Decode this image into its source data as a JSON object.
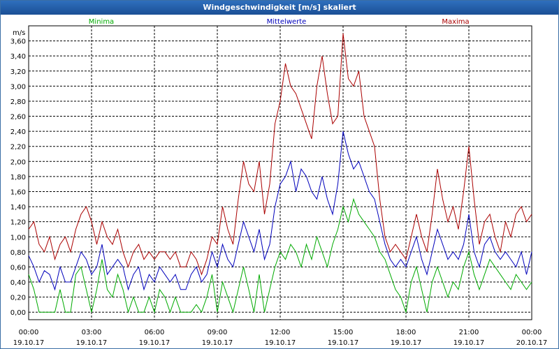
{
  "window": {
    "title": "Windgeschwindigkeit [m/s] skaliert"
  },
  "chart_data": {
    "type": "line",
    "title": "Windgeschwindigkeit [m/s] skaliert",
    "ylabel": "m/s",
    "ylim": [
      -0.1,
      3.8
    ],
    "y_ticks": [
      "0,00",
      "0,20",
      "0,40",
      "0,60",
      "0,80",
      "1,00",
      "1,20",
      "1,40",
      "1,60",
      "1,80",
      "2,00",
      "2,20",
      "2,40",
      "2,60",
      "2,80",
      "3,00",
      "3,20",
      "3,40",
      "3,60"
    ],
    "x_ticks": [
      {
        "time": "00:00",
        "date": "19.10.17"
      },
      {
        "time": "03:00",
        "date": "19.10.17"
      },
      {
        "time": "06:00",
        "date": "19.10.17"
      },
      {
        "time": "09:00",
        "date": "19.10.17"
      },
      {
        "time": "12:00",
        "date": "19.10.17"
      },
      {
        "time": "15:00",
        "date": "19.10.17"
      },
      {
        "time": "18:00",
        "date": "19.10.17"
      },
      {
        "time": "21:00",
        "date": "19.10.17"
      },
      {
        "time": "00:00",
        "date": "20.10.17"
      }
    ],
    "xlim_hours": [
      0,
      24
    ],
    "grid": true,
    "legend_position": "top",
    "series": [
      {
        "name": "Minima",
        "color": "#00aa00",
        "x_hours": [
          0,
          0.25,
          0.5,
          0.75,
          1,
          1.25,
          1.5,
          1.75,
          2,
          2.25,
          2.5,
          2.75,
          3,
          3.25,
          3.5,
          3.75,
          4,
          4.25,
          4.5,
          4.75,
          5,
          5.25,
          5.5,
          5.75,
          6,
          6.25,
          6.5,
          6.75,
          7,
          7.25,
          7.5,
          7.75,
          8,
          8.25,
          8.5,
          8.75,
          9,
          9.25,
          9.5,
          9.75,
          10,
          10.25,
          10.5,
          10.75,
          11,
          11.25,
          11.5,
          11.75,
          12,
          12.25,
          12.5,
          12.75,
          13,
          13.25,
          13.5,
          13.75,
          14,
          14.25,
          14.5,
          14.75,
          15,
          15.25,
          15.5,
          15.75,
          16,
          16.25,
          16.5,
          16.75,
          17,
          17.25,
          17.5,
          17.75,
          18,
          18.25,
          18.5,
          18.75,
          19,
          19.25,
          19.5,
          19.75,
          20,
          20.25,
          20.5,
          20.75,
          21,
          21.25,
          21.5,
          21.75,
          22,
          22.25,
          22.5,
          22.75,
          23,
          23.25,
          23.5,
          23.75,
          24
        ],
        "values": [
          0.5,
          0.3,
          0,
          0,
          0,
          0,
          0.3,
          0,
          0,
          0.5,
          0.6,
          0.3,
          0,
          0.3,
          0.7,
          0.3,
          0.2,
          0.5,
          0.3,
          0,
          0.2,
          0,
          0,
          0.2,
          0,
          0.3,
          0.2,
          0,
          0.2,
          0,
          0,
          0,
          0.1,
          0,
          0.2,
          0.5,
          0,
          0.4,
          0.2,
          0,
          0.3,
          0.6,
          0.3,
          0,
          0.5,
          0,
          0.3,
          0.6,
          0.8,
          0.7,
          0.9,
          0.8,
          0.6,
          0.9,
          0.7,
          1,
          0.8,
          0.6,
          0.9,
          1.1,
          1.4,
          1.2,
          1.5,
          1.3,
          1.2,
          1.1,
          1,
          0.8,
          0.7,
          0.5,
          0.3,
          0.2,
          0,
          0.4,
          0.6,
          0.3,
          0,
          0.4,
          0.6,
          0.4,
          0.2,
          0.4,
          0.3,
          0.6,
          0.8,
          0.5,
          0.3,
          0.5,
          0.7,
          0.6,
          0.5,
          0.4,
          0.3,
          0.5,
          0.4,
          0.3,
          0.4
        ]
      },
      {
        "name": "Mittelwerte",
        "color": "#0000bb",
        "x_hours": [
          0,
          0.25,
          0.5,
          0.75,
          1,
          1.25,
          1.5,
          1.75,
          2,
          2.25,
          2.5,
          2.75,
          3,
          3.25,
          3.5,
          3.75,
          4,
          4.25,
          4.5,
          4.75,
          5,
          5.25,
          5.5,
          5.75,
          6,
          6.25,
          6.5,
          6.75,
          7,
          7.25,
          7.5,
          7.75,
          8,
          8.25,
          8.5,
          8.75,
          9,
          9.25,
          9.5,
          9.75,
          10,
          10.25,
          10.5,
          10.75,
          11,
          11.25,
          11.5,
          11.75,
          12,
          12.25,
          12.5,
          12.75,
          13,
          13.25,
          13.5,
          13.75,
          14,
          14.25,
          14.5,
          14.75,
          15,
          15.25,
          15.5,
          15.75,
          16,
          16.25,
          16.5,
          16.75,
          17,
          17.25,
          17.5,
          17.75,
          18,
          18.25,
          18.5,
          18.75,
          19,
          19.25,
          19.5,
          19.75,
          20,
          20.25,
          20.5,
          20.75,
          21,
          21.25,
          21.5,
          21.75,
          22,
          22.25,
          22.5,
          22.75,
          23,
          23.25,
          23.5,
          23.75,
          24
        ],
        "values": [
          0.75,
          0.6,
          0.4,
          0.55,
          0.5,
          0.3,
          0.6,
          0.4,
          0.4,
          0.6,
          0.8,
          0.7,
          0.5,
          0.6,
          0.9,
          0.5,
          0.6,
          0.7,
          0.6,
          0.3,
          0.5,
          0.6,
          0.3,
          0.5,
          0.4,
          0.6,
          0.5,
          0.4,
          0.5,
          0.3,
          0.3,
          0.5,
          0.6,
          0.4,
          0.5,
          0.8,
          0.6,
          0.9,
          0.7,
          0.6,
          0.9,
          1.2,
          1.0,
          0.8,
          1.1,
          0.7,
          0.9,
          1.4,
          1.7,
          1.8,
          2.0,
          1.6,
          1.9,
          1.8,
          1.6,
          1.5,
          1.8,
          1.5,
          1.3,
          1.7,
          2.4,
          2.1,
          1.9,
          2.0,
          1.8,
          1.6,
          1.5,
          1.2,
          0.9,
          0.7,
          0.6,
          0.7,
          0.6,
          0.8,
          1.0,
          0.7,
          0.5,
          0.8,
          1.1,
          0.9,
          0.7,
          0.8,
          0.7,
          0.9,
          1.3,
          0.8,
          0.6,
          0.9,
          1.0,
          0.8,
          0.7,
          0.8,
          0.7,
          0.6,
          0.8,
          0.5,
          0.8
        ]
      },
      {
        "name": "Maxima",
        "color": "#aa0000",
        "x_hours": [
          0,
          0.25,
          0.5,
          0.75,
          1,
          1.25,
          1.5,
          1.75,
          2,
          2.25,
          2.5,
          2.75,
          3,
          3.25,
          3.5,
          3.75,
          4,
          4.25,
          4.5,
          4.75,
          5,
          5.25,
          5.5,
          5.75,
          6,
          6.25,
          6.5,
          6.75,
          7,
          7.25,
          7.5,
          7.75,
          8,
          8.25,
          8.5,
          8.75,
          9,
          9.25,
          9.5,
          9.75,
          10,
          10.25,
          10.5,
          10.75,
          11,
          11.25,
          11.5,
          11.75,
          12,
          12.25,
          12.5,
          12.75,
          13,
          13.25,
          13.5,
          13.75,
          14,
          14.25,
          14.5,
          14.75,
          15,
          15.25,
          15.5,
          15.75,
          16,
          16.25,
          16.5,
          16.75,
          17,
          17.25,
          17.5,
          17.75,
          18,
          18.25,
          18.5,
          18.75,
          19,
          19.25,
          19.5,
          19.75,
          20,
          20.25,
          20.5,
          20.75,
          21,
          21.25,
          21.5,
          21.75,
          22,
          22.25,
          22.5,
          22.75,
          23,
          23.25,
          23.5,
          23.75,
          24
        ],
        "values": [
          1.1,
          1.2,
          0.9,
          0.8,
          1.0,
          0.7,
          0.9,
          1.0,
          0.8,
          1.1,
          1.3,
          1.4,
          1.2,
          0.9,
          1.2,
          1.0,
          0.9,
          1.1,
          0.8,
          0.6,
          0.8,
          0.9,
          0.7,
          0.8,
          0.7,
          0.8,
          0.8,
          0.7,
          0.8,
          0.6,
          0.6,
          0.8,
          0.7,
          0.5,
          0.7,
          1.0,
          0.9,
          1.4,
          1.1,
          0.9,
          1.5,
          2.0,
          1.7,
          1.6,
          2.0,
          1.3,
          1.7,
          2.5,
          2.8,
          3.3,
          3.0,
          2.9,
          2.7,
          2.5,
          2.3,
          3.0,
          3.4,
          2.9,
          2.5,
          2.6,
          3.7,
          3.1,
          3.0,
          3.2,
          2.6,
          2.4,
          2.2,
          1.5,
          1.0,
          0.8,
          0.9,
          0.8,
          0.7,
          1.0,
          1.3,
          1.0,
          0.8,
          1.3,
          1.9,
          1.5,
          1.2,
          1.4,
          1.1,
          1.6,
          2.2,
          1.5,
          0.9,
          1.2,
          1.3,
          1.0,
          0.8,
          1.2,
          1.0,
          1.3,
          1.4,
          1.2,
          1.3
        ]
      }
    ]
  }
}
